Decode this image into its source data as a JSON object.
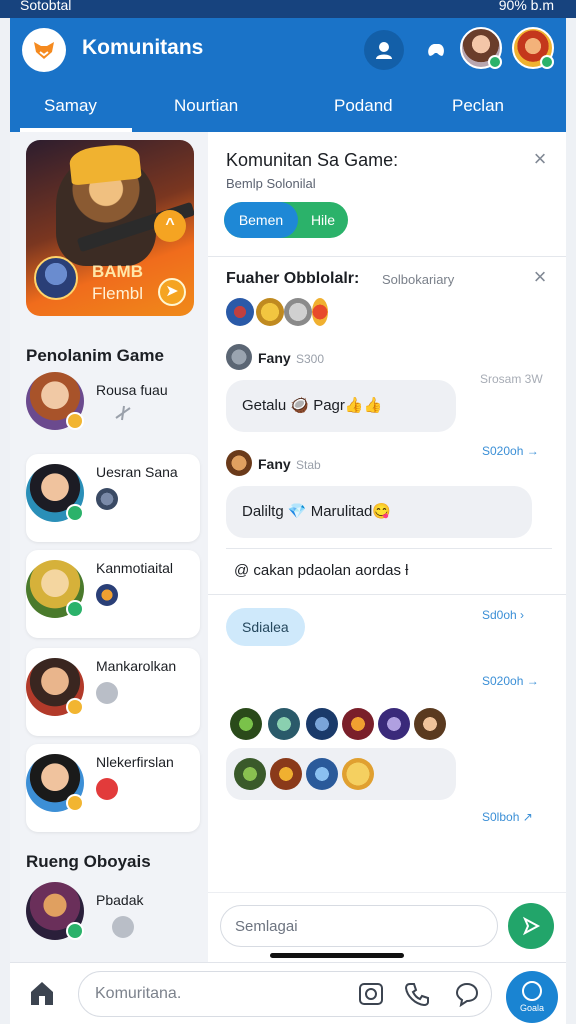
{
  "status_bar": {
    "left": "Sotobtal",
    "right": "90% b.m"
  },
  "app": {
    "title": "Komunitans"
  },
  "tabs": [
    {
      "label": "Samay",
      "active": true
    },
    {
      "label": "Nourtian"
    },
    {
      "label": "Podand"
    },
    {
      "label": "Peclan"
    }
  ],
  "banner": {
    "line1": "BAMB",
    "line2": "Flembl"
  },
  "sidebar": {
    "section1_title": "Penolanim Game",
    "section2_title": "Rueng Oboyais",
    "members": [
      {
        "name": "Rousa fuau",
        "card": false
      },
      {
        "name": "Uesran Sana",
        "card": true
      },
      {
        "name": "Kanmotiaital",
        "card": true
      },
      {
        "name": "Mankarolkan",
        "card": true
      },
      {
        "name": "Nlekerfirslan",
        "card": true
      },
      {
        "name": "Pbadak",
        "card": false
      }
    ]
  },
  "community": {
    "title": "Komunitan Sa Game:",
    "subtitle": "Bemlp Solonilal",
    "seg_active": "Bemen",
    "seg_other": "Hile"
  },
  "featured": {
    "title": "Fuaher Obblolalr:",
    "subtitle": "Solbokariary"
  },
  "messages": [
    {
      "user": "Fany",
      "time": "S300",
      "text": "Getalu 🥥 Pagr👍👍",
      "side_time": "Srosam 3W"
    },
    {
      "user": "Fany",
      "time": "Stab",
      "text": "Daliltg 💎 Marulitad😋",
      "side_time": "S020oh →"
    }
  ],
  "system_message": "@ cakan pdaolan aordas ƚ",
  "schedule": {
    "label": "Sdialea",
    "time1": "Sd0oh ›",
    "time2": "S020oh →",
    "time3": "S0lboh ↗"
  },
  "composer": {
    "placeholder": "Semlagai"
  },
  "bottom_bar": {
    "search_placeholder": "Komuritana.",
    "fab_label": "Goala"
  },
  "colors": {
    "primary": "#1a73c8",
    "accent_green": "#22a56a",
    "brand_orange": "#f58a1f"
  }
}
